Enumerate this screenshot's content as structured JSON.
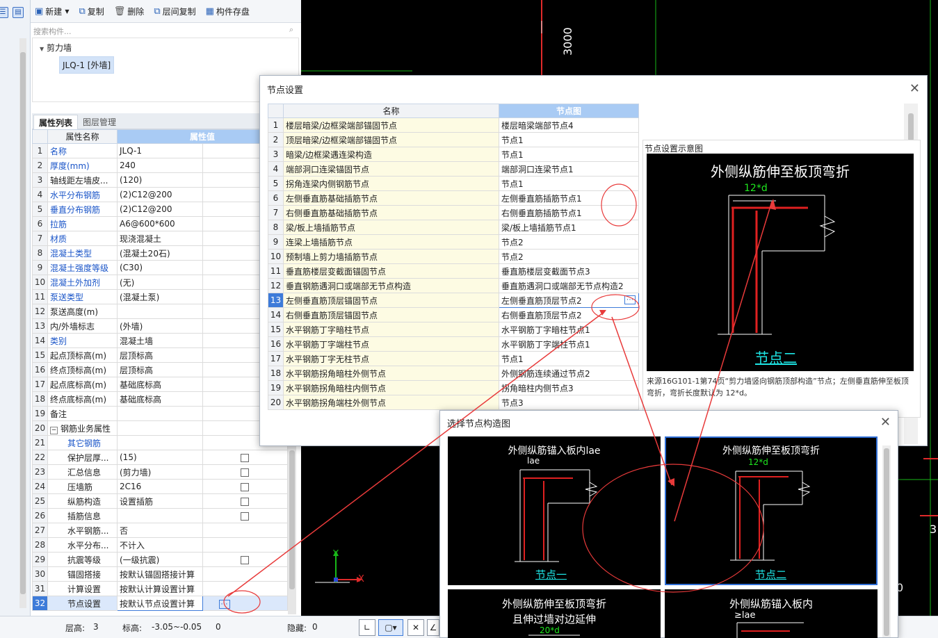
{
  "toolbar": {
    "new_label": "新建",
    "copy_label": "复制",
    "delete_label": "删除",
    "floor_copy_label": "层间复制",
    "save_label": "构件存盘"
  },
  "search": {
    "placeholder": "搜索构件..."
  },
  "tree": {
    "group": "剪力墙",
    "item": "JLQ-1 [外墙]"
  },
  "prop_tabs": {
    "active": "属性列表",
    "inactive": "图层管理"
  },
  "prop_header": {
    "name": "属性名称",
    "value": "属性值"
  },
  "props": [
    {
      "n": "1",
      "k": "名称",
      "v": "JLQ-1",
      "blue": true
    },
    {
      "n": "2",
      "k": "厚度(mm)",
      "v": "240",
      "blue": true
    },
    {
      "n": "3",
      "k": "轴线距左墙皮...",
      "v": "(120)"
    },
    {
      "n": "4",
      "k": "水平分布钢筋",
      "v": "(2)C12@200",
      "blue": true
    },
    {
      "n": "5",
      "k": "垂直分布钢筋",
      "v": "(2)C12@200",
      "blue": true
    },
    {
      "n": "6",
      "k": "拉筋",
      "v": "A6@600*600",
      "blue": true
    },
    {
      "n": "7",
      "k": "材质",
      "v": "现浇混凝土",
      "blue": true
    },
    {
      "n": "8",
      "k": "混凝土类型",
      "v": "(混凝土20石)",
      "blue": true
    },
    {
      "n": "9",
      "k": "混凝土强度等级",
      "v": "(C30)",
      "blue": true
    },
    {
      "n": "10",
      "k": "混凝土外加剂",
      "v": "(无)",
      "blue": true
    },
    {
      "n": "11",
      "k": "泵送类型",
      "v": "(混凝土泵)",
      "blue": true
    },
    {
      "n": "12",
      "k": "泵送高度(m)",
      "v": ""
    },
    {
      "n": "13",
      "k": "内/外墙标志",
      "v": "(外墙)"
    },
    {
      "n": "14",
      "k": "类别",
      "v": "混凝土墙",
      "blue": true
    },
    {
      "n": "15",
      "k": "起点顶标高(m)",
      "v": "层顶标高"
    },
    {
      "n": "16",
      "k": "终点顶标高(m)",
      "v": "层顶标高"
    },
    {
      "n": "17",
      "k": "起点底标高(m)",
      "v": "基础底标高"
    },
    {
      "n": "18",
      "k": "终点底标高(m)",
      "v": "基础底标高"
    },
    {
      "n": "19",
      "k": "备注",
      "v": ""
    },
    {
      "n": "20",
      "k": "钢筋业务属性",
      "v": "",
      "group": true
    },
    {
      "n": "21",
      "k": "其它钢筋",
      "v": "",
      "blue": true,
      "indent": true
    },
    {
      "n": "22",
      "k": "保护层厚...",
      "v": "(15)",
      "indent": true,
      "cb": true
    },
    {
      "n": "23",
      "k": "汇总信息",
      "v": "(剪力墙)",
      "indent": true,
      "cb": true
    },
    {
      "n": "24",
      "k": "压墙筋",
      "v": "2C16",
      "indent": true,
      "cb": true
    },
    {
      "n": "25",
      "k": "纵筋构造",
      "v": "设置插筋",
      "indent": true,
      "cb": true
    },
    {
      "n": "26",
      "k": "插筋信息",
      "v": "",
      "indent": true,
      "cb": true
    },
    {
      "n": "27",
      "k": "水平钢筋...",
      "v": "否",
      "indent": true
    },
    {
      "n": "28",
      "k": "水平分布...",
      "v": "不计入",
      "indent": true
    },
    {
      "n": "29",
      "k": "抗震等级",
      "v": "(一级抗震)",
      "indent": true,
      "cb": true
    },
    {
      "n": "30",
      "k": "锚固搭接",
      "v": "按默认锚固搭接计算",
      "indent": true
    },
    {
      "n": "31",
      "k": "计算设置",
      "v": "按默认计算设置计算",
      "indent": true
    },
    {
      "n": "32",
      "k": "节点设置",
      "v": "按默认节点设置计算",
      "indent": true,
      "sel": true
    }
  ],
  "status": {
    "floor_h_label": "层高:",
    "floor_h": "3",
    "elev_label": "标高:",
    "elev": "-3.05~-0.05",
    "zero": "0",
    "hidden_label": "隐藏:",
    "hidden": "0"
  },
  "cad": {
    "dim1": "3000",
    "right_3": "3",
    "right_0": "0",
    "axis_x": "X",
    "axis_y": "Y"
  },
  "node_dialog": {
    "title": "节点设置",
    "col_name": "名称",
    "col_node": "节点图",
    "rows": [
      {
        "n": "1",
        "k": "楼层暗梁/边框梁端部锚固节点",
        "v": "楼层暗梁端部节点4"
      },
      {
        "n": "2",
        "k": "顶层暗梁/边框梁端部锚固节点",
        "v": "节点1"
      },
      {
        "n": "3",
        "k": "暗梁/边框梁遇连梁构造",
        "v": "节点1"
      },
      {
        "n": "4",
        "k": "端部洞口连梁锚固节点",
        "v": "端部洞口连梁节点1"
      },
      {
        "n": "5",
        "k": "拐角连梁内侧钢筋节点",
        "v": "节点1"
      },
      {
        "n": "6",
        "k": "左侧垂直筋基础插筋节点",
        "v": "左侧垂直筋插筋节点1"
      },
      {
        "n": "7",
        "k": "右侧垂直筋基础插筋节点",
        "v": "右侧垂直筋插筋节点1"
      },
      {
        "n": "8",
        "k": "梁/板上墙插筋节点",
        "v": "梁/板上墙插筋节点1"
      },
      {
        "n": "9",
        "k": "连梁上墙插筋节点",
        "v": "节点2"
      },
      {
        "n": "10",
        "k": "预制墙上剪力墙插筋节点",
        "v": "节点2"
      },
      {
        "n": "11",
        "k": "垂直筋楼层变截面锚固节点",
        "v": "垂直筋楼层变截面节点3"
      },
      {
        "n": "12",
        "k": "垂直钢筋遇洞口或端部无节点构造",
        "v": "垂直筋遇洞口或端部无节点构造2"
      },
      {
        "n": "13",
        "k": "左侧垂直筋顶层锚固节点",
        "v": "左侧垂直筋顶层节点2",
        "sel": true
      },
      {
        "n": "14",
        "k": "右侧垂直筋顶层锚固节点",
        "v": "右侧垂直筋顶层节点2"
      },
      {
        "n": "15",
        "k": "水平钢筋丁字暗柱节点",
        "v": "水平钢筋丁字暗柱节点1"
      },
      {
        "n": "16",
        "k": "水平钢筋丁字端柱节点",
        "v": "水平钢筋丁字端柱节点1"
      },
      {
        "n": "17",
        "k": "水平钢筋丁字无柱节点",
        "v": "节点1"
      },
      {
        "n": "18",
        "k": "水平钢筋拐角暗柱外侧节点",
        "v": "外侧钢筋连续通过节点2"
      },
      {
        "n": "19",
        "k": "水平钢筋拐角暗柱内侧节点",
        "v": "拐角暗柱内侧节点3"
      },
      {
        "n": "20",
        "k": "水平钢筋拐角端柱外侧节点",
        "v": "节点3"
      }
    ],
    "preview_title": "节点设置示意图",
    "preview_heading": "外侧纵筋伸至板顶弯折",
    "preview_dim": "12*d",
    "preview_node": "节点二",
    "preview_desc": "来源16G101-1第74页“剪力墙竖向钢筋顶部构造”节点；左侧垂直筋伸至板顶弯折，弯折长度默认为 12*d。"
  },
  "choose_dialog": {
    "title": "选择节点构造图",
    "cards": [
      {
        "title": "外侧纵筋锚入板内lae",
        "dim": "lae",
        "node": "节点一"
      },
      {
        "title": "外侧纵筋伸至板顶弯折",
        "dim": "12*d",
        "node": "节点二"
      },
      {
        "title": "外侧纵筋伸至板顶弯折",
        "title2": "且伸过墙对边延伸",
        "dim": "20*d"
      },
      {
        "title": "外侧纵筋锚入板内",
        "dim": "≥lae"
      }
    ]
  },
  "colors": {
    "accent": "#3d7bd9",
    "header_value": "#a9cbf4",
    "rebar": "#e02020",
    "annot": "#e83a3a",
    "node_text": "#1ee6e6"
  }
}
